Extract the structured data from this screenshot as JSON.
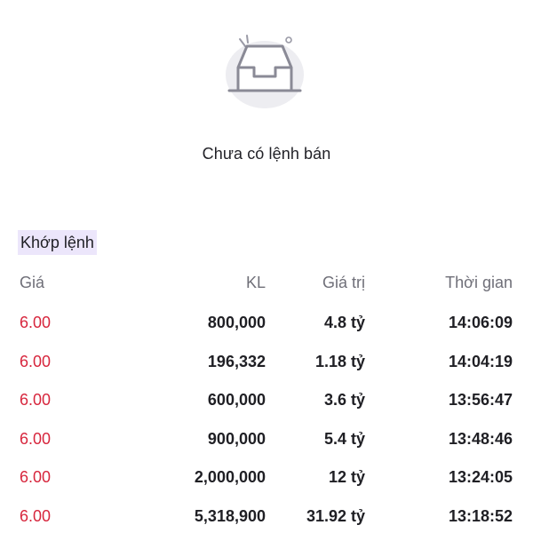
{
  "empty_state": {
    "illustration": "empty-tray-icon",
    "message": "Chưa có lệnh bán"
  },
  "matched": {
    "title": "Khớp lệnh",
    "columns": {
      "price": "Giá",
      "volume": "KL",
      "value": "Giá trị",
      "time": "Thời gian"
    },
    "rows": [
      {
        "price": "6.00",
        "volume": "800,000",
        "value": "4.8 tỷ",
        "time": "14:06:09"
      },
      {
        "price": "6.00",
        "volume": "196,332",
        "value": "1.18 tỷ",
        "time": "14:04:19"
      },
      {
        "price": "6.00",
        "volume": "600,000",
        "value": "3.6 tỷ",
        "time": "13:56:47"
      },
      {
        "price": "6.00",
        "volume": "900,000",
        "value": "5.4 tỷ",
        "time": "13:48:46"
      },
      {
        "price": "6.00",
        "volume": "2,000,000",
        "value": "12 tỷ",
        "time": "13:24:05"
      },
      {
        "price": "6.00",
        "volume": "5,318,900",
        "value": "31.92 tỷ",
        "time": "13:18:52"
      }
    ]
  },
  "colors": {
    "price_down": "#d7263d",
    "section_highlight": "#ece6fb",
    "header_text": "#6f6f78"
  }
}
